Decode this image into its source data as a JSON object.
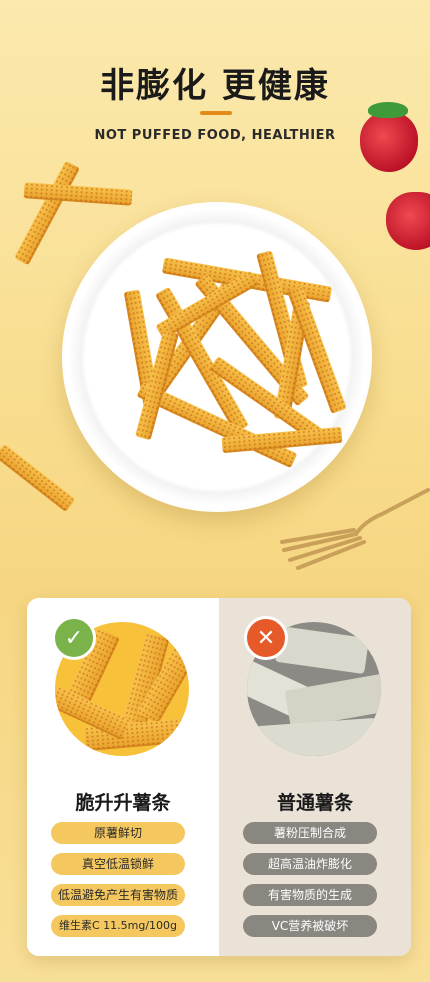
{
  "header": {
    "title": "非膨化 更健康",
    "subtitle": "NOT PUFFED FOOD, HEALTHIER"
  },
  "colors": {
    "accent": "#e48a1b",
    "good_badge": "#7ab34a",
    "bad_badge": "#e65a29",
    "good_pill": "#f5c85f",
    "bad_pill": "#8a8680"
  },
  "comparison": {
    "left": {
      "title": "脆升升薯条",
      "badge_icon": "check-icon",
      "features": [
        "原薯鲜切",
        "真空低温锁鲜",
        "低温避免产生有害物质",
        "维生素C 11.5mg/100g"
      ]
    },
    "right": {
      "title": "普通薯条",
      "badge_icon": "cross-icon",
      "features": [
        "薯粉压制合成",
        "超高温油炸膨化",
        "有害物质的生成",
        "VC营养被破坏"
      ]
    }
  }
}
